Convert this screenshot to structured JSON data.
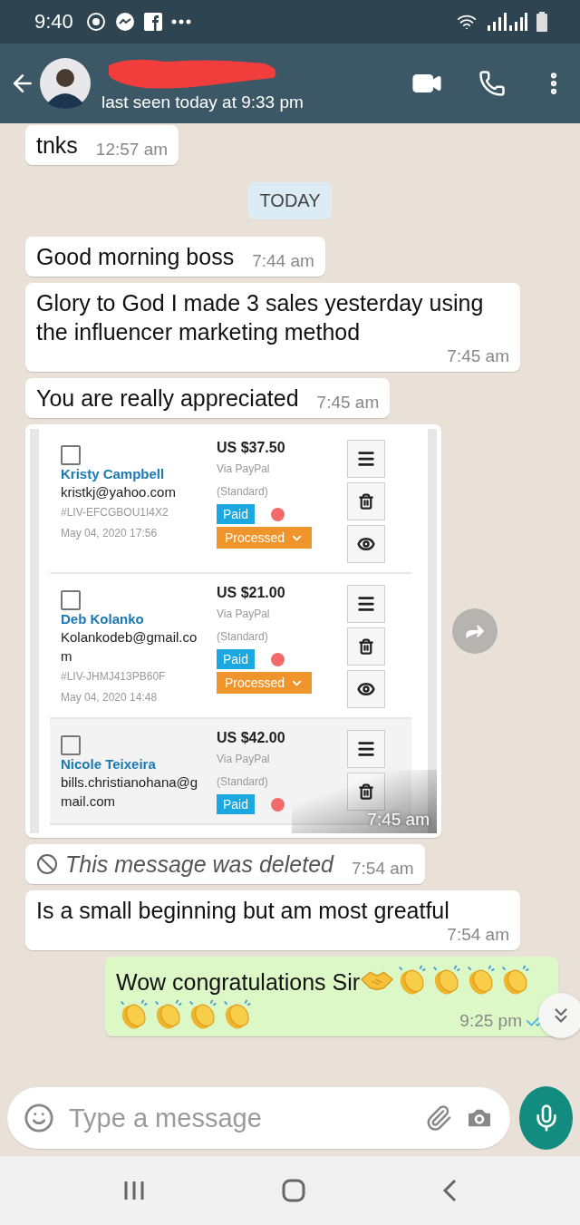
{
  "status_bar": {
    "time": "9:40"
  },
  "header": {
    "last_seen": "last seen today at 9:33 pm",
    "name_redacted": true
  },
  "messages": [
    {
      "kind": "incoming",
      "text": "tnks",
      "time": "12:57 am"
    },
    {
      "kind": "date",
      "text": "TODAY"
    },
    {
      "kind": "incoming",
      "text": "Good morning boss",
      "time": "7:44 am"
    },
    {
      "kind": "incoming",
      "text": "Glory to God I made 3 sales yesterday using the influencer marketing method",
      "time": "7:45 am"
    },
    {
      "kind": "incoming",
      "text": "You are really appreciated",
      "time": "7:45 am"
    },
    {
      "kind": "image",
      "time": "7:45 am",
      "orders": [
        {
          "name": "Kristy Campbell",
          "email": "kristkj@yahoo.com",
          "id": "#LIV-EFCGBOU1I4X2",
          "date": "May 04, 2020 17:56",
          "price": "US $37.50",
          "via": "Via PayPal",
          "plan": "(Standard)",
          "payment": "Paid",
          "dot": true,
          "status": "Processed",
          "actions": [
            {
              "kind": "menu"
            },
            {
              "kind": "delete"
            },
            {
              "kind": "view"
            }
          ],
          "highlighted": false
        },
        {
          "name": "Deb Kolanko",
          "email": "Kolankodeb@gmail.com",
          "id": "#LIV-JHMJ413PB60F",
          "date": "May 04, 2020 14:48",
          "price": "US $21.00",
          "via": "Via PayPal",
          "plan": "(Standard)",
          "payment": "Paid",
          "dot": true,
          "status": "Processed",
          "actions": [
            {
              "kind": "menu"
            },
            {
              "kind": "delete"
            },
            {
              "kind": "view"
            }
          ],
          "highlighted": false
        },
        {
          "name": "Nicole Teixeira",
          "email": "bills.christianohana@gmail.com",
          "price": "US $42.00",
          "via": "Via PayPal",
          "plan": "(Standard)",
          "payment": "Paid",
          "dot": true,
          "actions": [
            {
              "kind": "menu"
            },
            {
              "kind": "delete"
            }
          ],
          "highlighted": true
        }
      ]
    },
    {
      "kind": "deleted",
      "text": "This message was deleted",
      "time": "7:54 am"
    },
    {
      "kind": "incoming",
      "text": "Is a small beginning but am most greatful",
      "time": "7:54 am"
    },
    {
      "kind": "outgoing",
      "text": "Wow congratulations Sir",
      "emojis": [
        {
          "kind": "handshake"
        },
        {
          "kind": "clap"
        },
        {
          "kind": "clap"
        },
        {
          "kind": "clap"
        },
        {
          "kind": "clap"
        },
        {
          "kind": "clap"
        },
        {
          "kind": "clap"
        },
        {
          "kind": "clap"
        },
        {
          "kind": "clap"
        }
      ],
      "time": "9:25 pm",
      "read": true
    }
  ],
  "composer": {
    "placeholder": "Type a message"
  }
}
